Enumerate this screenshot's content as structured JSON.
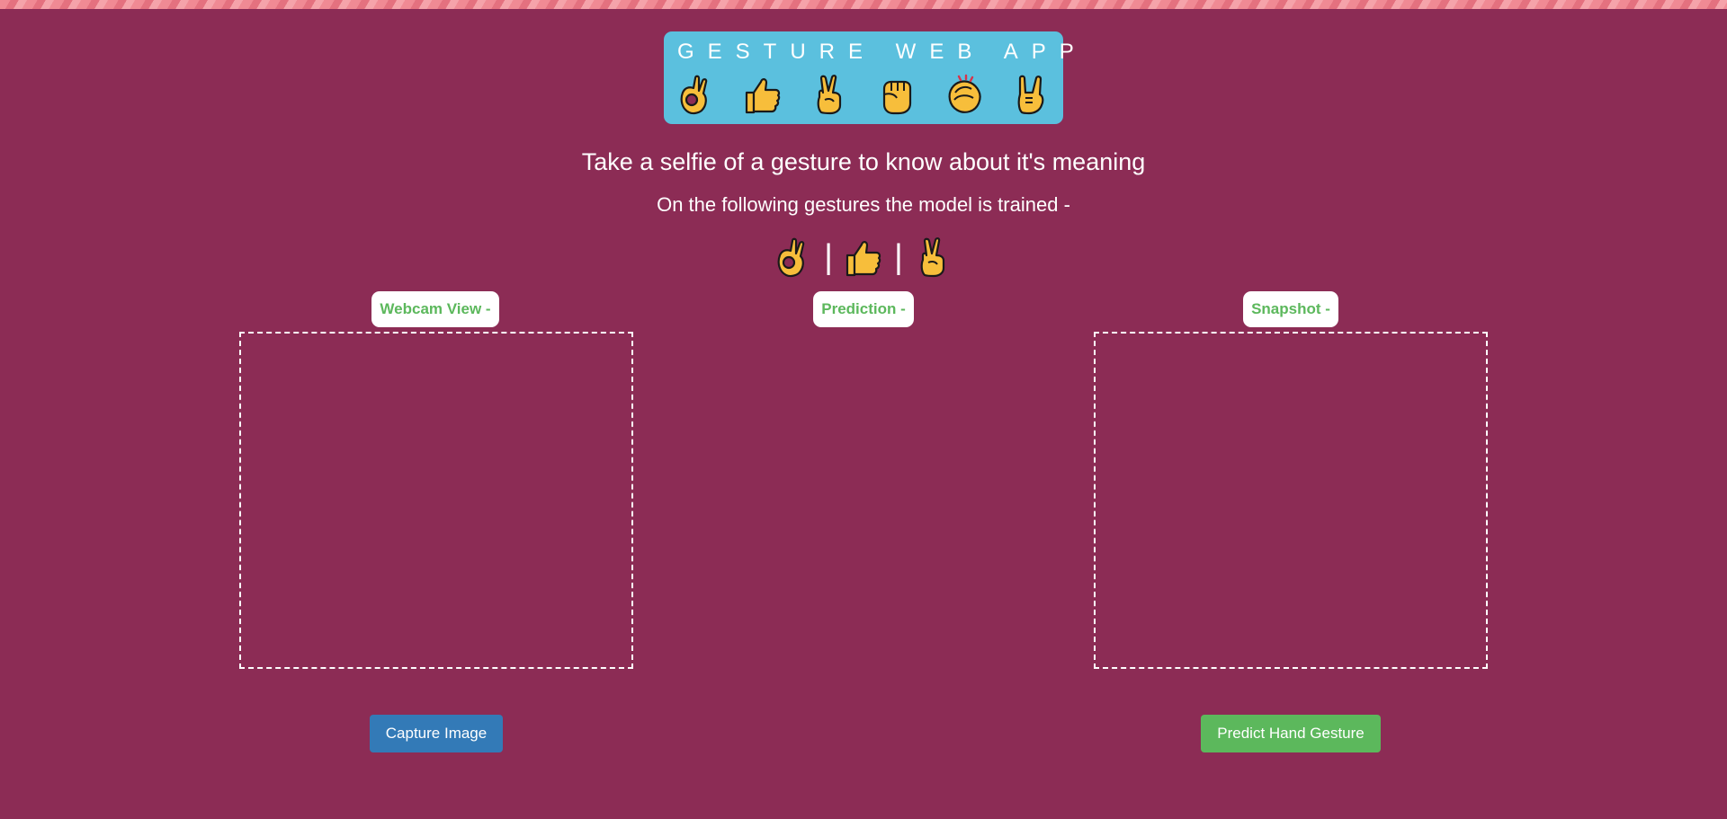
{
  "app": {
    "title": "GESTURE WEB APP",
    "header_emojis": [
      "ok-hand-icon",
      "thumbs-up-icon",
      "victory-hand-icon",
      "raised-fist-icon",
      "clapping-hands-icon",
      "sign-of-horns-icon"
    ]
  },
  "main": {
    "tagline": "Take a selfie of a gesture to know about it's meaning",
    "trained_intro": "On the following gestures the model is trained -",
    "trained_gestures": [
      "ok-hand-icon",
      "thumbs-up-icon",
      "victory-hand-icon"
    ],
    "separator": "|"
  },
  "panels": {
    "webcam_label": "Webcam View -",
    "prediction_label": "Prediction -",
    "snapshot_label": "Snapshot -"
  },
  "buttons": {
    "capture_label": "Capture Image",
    "predict_label": "Predict Hand Gesture"
  },
  "colors": {
    "background": "#8c2c55",
    "header_bg": "#5bc0de",
    "label_text": "#5cb85c",
    "capture_button": "#337ab7",
    "predict_button": "#5cb85c",
    "emoji_yellow": "#f7be3b"
  }
}
